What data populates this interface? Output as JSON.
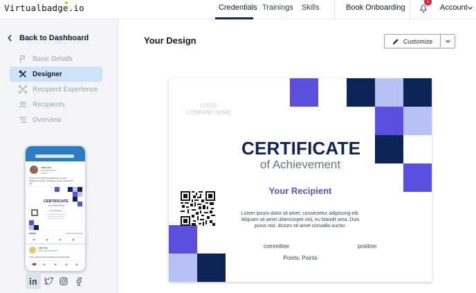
{
  "app": {
    "logo_text": "Virtualbadge.io"
  },
  "topnav": {
    "tabs": [
      {
        "label": "Credentials"
      },
      {
        "label": "Trainings"
      },
      {
        "label": "Skills"
      }
    ],
    "book_onboarding": "Book Onboarding",
    "notifications_count": "1",
    "account": "Account"
  },
  "sidebar": {
    "back_label": "Back to Dashboard",
    "items": [
      {
        "label": "Basic Details",
        "icon": "flag-icon"
      },
      {
        "label": "Designer",
        "icon": "designer-tools-icon"
      },
      {
        "label": "Recipient Experience",
        "icon": "network-icon"
      },
      {
        "label": "Recipients",
        "icon": "people-icon"
      },
      {
        "label": "Overview",
        "icon": "list-icon"
      }
    ],
    "phone_preview": {
      "post_name": "Jane Doe",
      "post_text": "I have successfully completed the course \"Example Course\". Thanks to all who supported me!",
      "cert_title": "CERTIFICATE",
      "cert_sub": "of Achievement",
      "recipient": "Your Recipient",
      "commenter": "Lisa Frid",
      "comment": "I have discovered something amazing today"
    },
    "socials": [
      "linkedin-icon",
      "twitter-icon",
      "instagram-icon",
      "facebook-icon"
    ]
  },
  "main": {
    "title": "Your Design",
    "customize_label": "Customize"
  },
  "certificate": {
    "logo_line1": "LOGO",
    "logo_line2": "COMPANY NAME",
    "title": "CERTIFICATE",
    "subtitle": "of Achievement",
    "recipient": "Your Recipient",
    "body": "Lorem ipsum dolor sit amet, consectetur adipiscing elit. Aliquam sit amet ullamcorper nisl, eu blandit urna. Duis purus nisl, dictum sit amet convallis auctor.",
    "signature_left": "committee",
    "signature_right": "position",
    "points": "Points: Points"
  },
  "colors": {
    "navy": "#0e2358",
    "purple": "#5b4fe0",
    "lavender": "#b8c1f5",
    "active_nav": "#cde4f6"
  }
}
